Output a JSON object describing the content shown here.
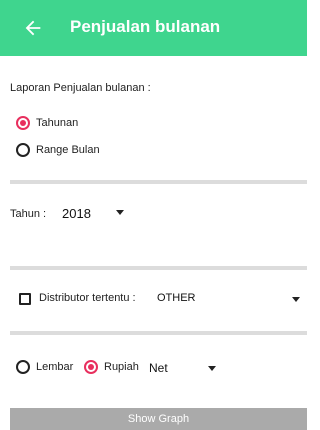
{
  "app_bar": {
    "title": "Penjualan bulanan",
    "color": "#3fd58e"
  },
  "intro_text": "Laporan Penjualan bulanan :",
  "report_type": {
    "options": [
      {
        "label": "Tahunan",
        "checked": true
      },
      {
        "label": "Range Bulan",
        "checked": false
      }
    ]
  },
  "year": {
    "label": "Tahun :",
    "value": "2018"
  },
  "distributor": {
    "label": "Distributor tertentu :",
    "value": "OTHER",
    "checked": false
  },
  "unit": {
    "options": [
      {
        "label": "Lembar",
        "checked": false
      },
      {
        "label": "Rupiah",
        "checked": true
      }
    ],
    "type_value": "Net"
  },
  "show_graph_button": "Show Graph",
  "accent_color": "#e82f5e"
}
